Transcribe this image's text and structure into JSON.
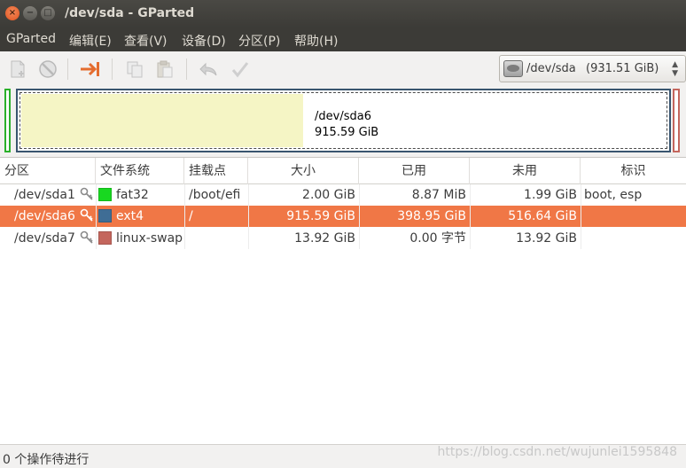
{
  "window": {
    "title": "/dev/sda - GParted",
    "close_glyph": "×",
    "min_glyph": "−",
    "max_glyph": "□"
  },
  "menu": [
    {
      "label": "GParted"
    },
    {
      "label": "编辑(E)"
    },
    {
      "label": "查看(V)"
    },
    {
      "label": "设备(D)"
    },
    {
      "label": "分区(P)"
    },
    {
      "label": "帮助(H)"
    }
  ],
  "toolbar": {
    "icons": [
      "new-partition-icon",
      "delete-icon",
      "resize-move-icon",
      "copy-icon",
      "paste-icon",
      "undo-icon",
      "apply-icon"
    ]
  },
  "device": {
    "name": "/dev/sda",
    "size": "(931.51 GiB)",
    "arrows": "▲▼"
  },
  "diskmap": {
    "selected_name": "/dev/sda6",
    "selected_size": "915.59 GiB",
    "used_fraction": 0.436
  },
  "table": {
    "headers": [
      "分区",
      "文件系统",
      "挂载点",
      "大小",
      "已用",
      "未用",
      "标识"
    ],
    "rows": [
      {
        "partition": "/dev/sda1",
        "fs": "fat32",
        "fs_color": "#18d820",
        "mount": "/boot/efi",
        "size": "2.00 GiB",
        "used": "8.87 MiB",
        "unused": "1.99 GiB",
        "flags": "boot, esp"
      },
      {
        "partition": "/dev/sda6",
        "fs": "ext4",
        "fs_color": "#3f6d95",
        "mount": "/",
        "size": "915.59 GiB",
        "used": "398.95 GiB",
        "unused": "516.64 GiB",
        "flags": ""
      },
      {
        "partition": "/dev/sda7",
        "fs": "linux-swap",
        "fs_color": "#c4665d",
        "mount": "",
        "size": "13.92 GiB",
        "used": "0.00 字节",
        "unused": "13.92 GiB",
        "flags": ""
      }
    ]
  },
  "status": {
    "text": "0 个操作待进行",
    "watermark": "https://blog.csdn.net/wujunlei1595848"
  },
  "colors": {
    "selection": "#f07746",
    "titlebar": "#3c3b37",
    "used_fill": "#f5f5c5"
  }
}
